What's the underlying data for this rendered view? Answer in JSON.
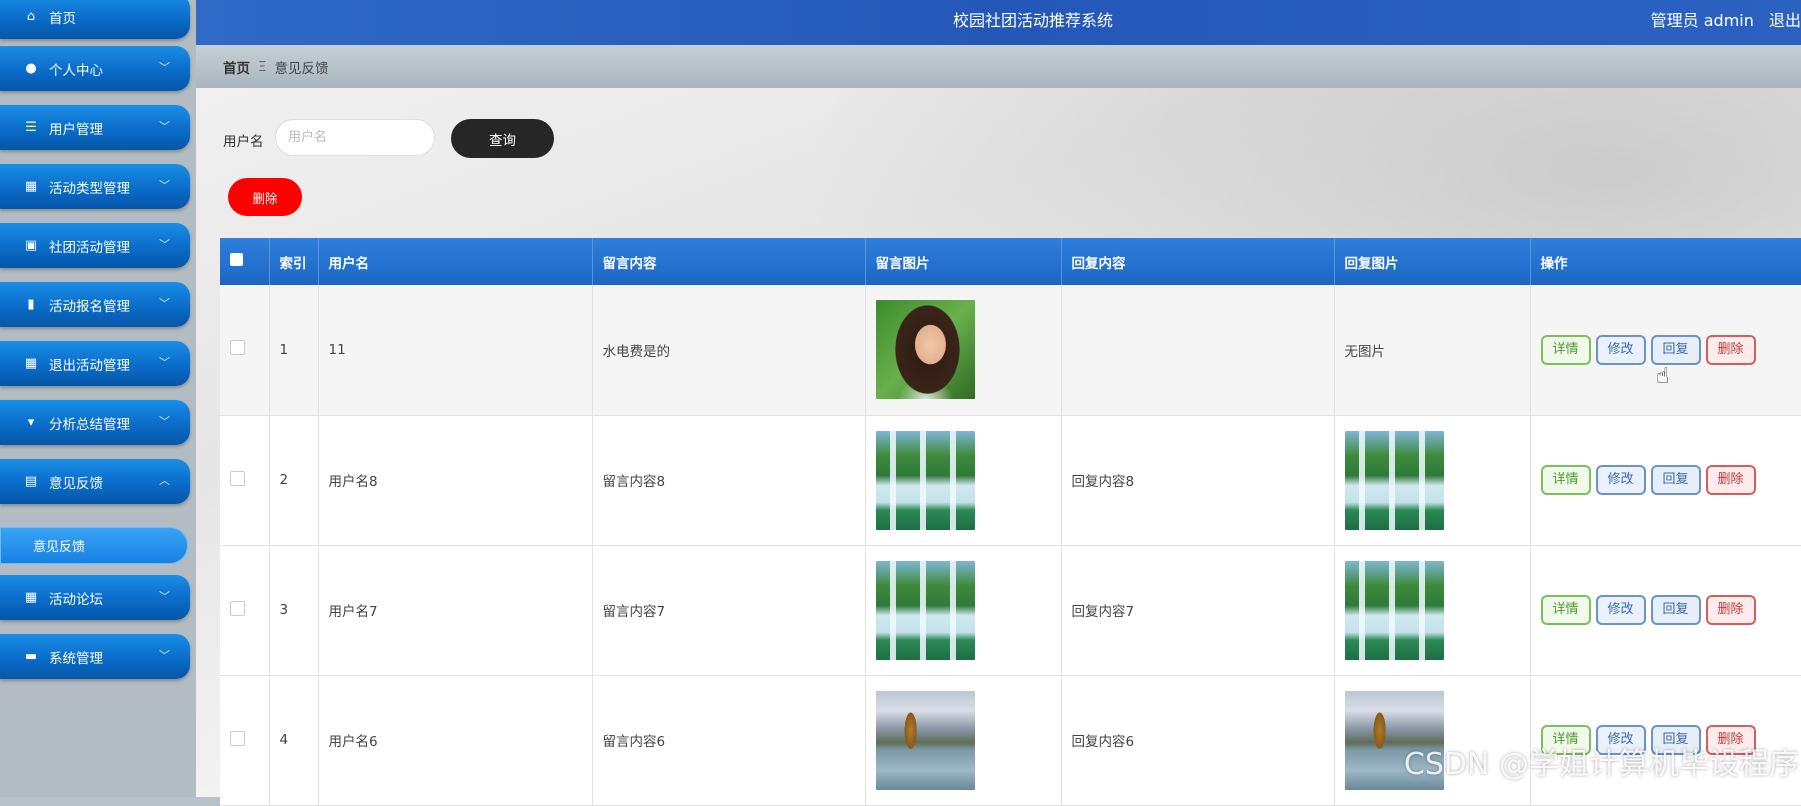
{
  "header": {
    "app_title": "校园社团活动推荐系统",
    "user_label": "管理员 admin",
    "logout_label": "退出"
  },
  "sidebar": {
    "items": [
      {
        "label": "首页",
        "icon": "home-icon",
        "has_chevron": false
      },
      {
        "label": "个人中心",
        "icon": "user-icon",
        "has_chevron": true
      },
      {
        "label": "用户管理",
        "icon": "list-icon",
        "has_chevron": true
      },
      {
        "label": "活动类型管理",
        "icon": "grid-icon",
        "has_chevron": true
      },
      {
        "label": "社团活动管理",
        "icon": "clipboard-icon",
        "has_chevron": true
      },
      {
        "label": "活动报名管理",
        "icon": "bar-chart-icon",
        "has_chevron": true
      },
      {
        "label": "退出活动管理",
        "icon": "grid-icon",
        "has_chevron": true
      },
      {
        "label": "分析总结管理",
        "icon": "pin-icon",
        "has_chevron": true
      },
      {
        "label": "意见反馈",
        "icon": "briefcase-icon",
        "has_chevron": true,
        "expanded": true
      },
      {
        "label": "活动论坛",
        "icon": "grid-icon",
        "has_chevron": true
      },
      {
        "label": "系统管理",
        "icon": "monitor-icon",
        "has_chevron": true
      }
    ],
    "sub_item": {
      "label": "意见反馈"
    }
  },
  "breadcrumb": {
    "home": "首页",
    "separator": "Ξ",
    "current": "意见反馈"
  },
  "search": {
    "label": "用户名",
    "placeholder": "用户名",
    "value": "",
    "button_label": "查询"
  },
  "toolbar": {
    "delete_label": "删除"
  },
  "table": {
    "columns": [
      "",
      "索引",
      "用户名",
      "留言内容",
      "留言图片",
      "回复内容",
      "回复图片",
      "操作"
    ],
    "rows": [
      {
        "index": "1",
        "username": "11",
        "content": "水电费是的",
        "image": "portrait-photo",
        "reply": "",
        "reply_image": "无图片"
      },
      {
        "index": "2",
        "username": "用户名8",
        "content": "留言内容8",
        "image": "waterfall-photo",
        "reply": "回复内容8",
        "reply_image": "waterfall-photo"
      },
      {
        "index": "3",
        "username": "用户名7",
        "content": "留言内容7",
        "image": "waterfall-photo",
        "reply": "回复内容7",
        "reply_image": "waterfall-photo"
      },
      {
        "index": "4",
        "username": "用户名6",
        "content": "留言内容6",
        "image": "lake-photo",
        "reply": "回复内容6",
        "reply_image": "lake-photo"
      }
    ],
    "actions": {
      "detail": "详情",
      "edit": "修改",
      "reply": "回复",
      "delete": "删除"
    }
  },
  "watermark": "CSDN @学姐计算机毕设程序",
  "colors": {
    "header_blue": "#2458b8",
    "sidebar_blue": "#0a6cc9",
    "table_header_blue": "#1c66c4",
    "delete_red": "#ff0000",
    "search_button_dark": "#262626"
  }
}
